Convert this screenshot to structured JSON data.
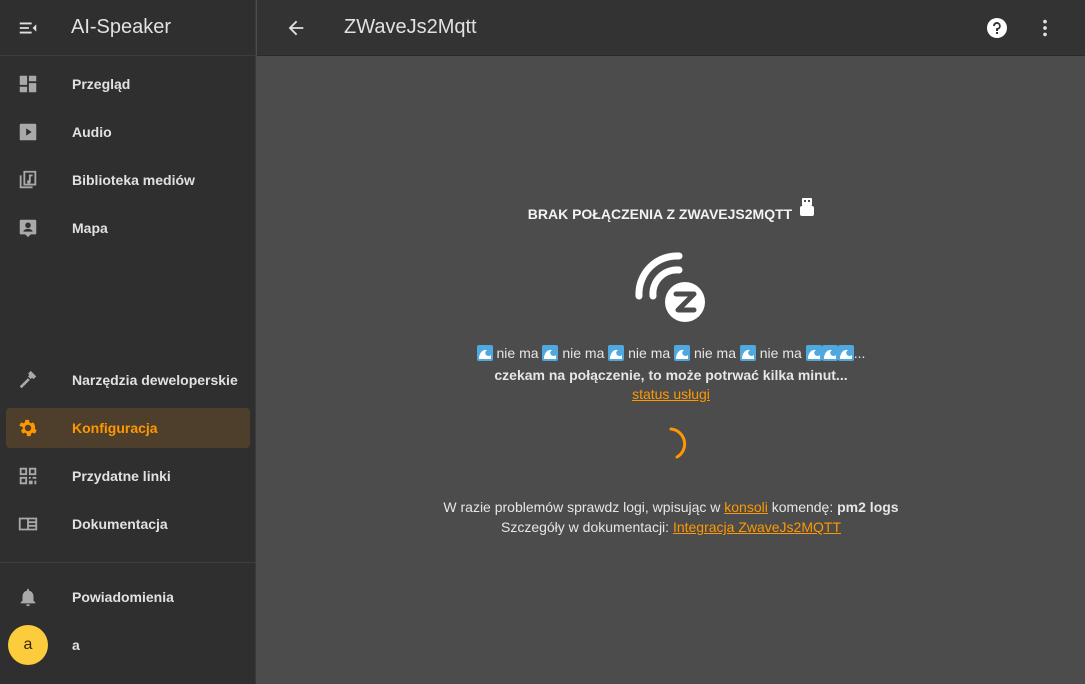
{
  "sidebar": {
    "app_title": "AI-Speaker",
    "items": [
      {
        "label": "Przegląd",
        "icon": "dashboard-icon"
      },
      {
        "label": "Audio",
        "icon": "play-box-icon"
      },
      {
        "label": "Biblioteka mediów",
        "icon": "music-library-icon"
      },
      {
        "label": "Mapa",
        "icon": "account-box-icon"
      },
      {
        "label": "Narzędzia deweloperskie",
        "icon": "hammer-icon"
      },
      {
        "label": "Konfiguracja",
        "icon": "gear-icon"
      },
      {
        "label": "Przydatne linki",
        "icon": "qrcode-icon"
      },
      {
        "label": "Dokumentacja",
        "icon": "book-icon"
      }
    ],
    "notifications_label": "Powiadomienia",
    "user_initial": "a",
    "user_name": "a"
  },
  "topbar": {
    "title": "ZWaveJs2Mqtt"
  },
  "main": {
    "heading": "BRAK POŁĄCZENIA Z ZWAVEJS2MQTT",
    "nie_ma": "nie ma",
    "ellipsis": "...",
    "waiting": "czekam na połączenie, to może potrwać kilka minut...",
    "status_link": "status usługi",
    "help_prefix": "W razie problemów sprawdz logi, wpisując w ",
    "console_link": "konsoli",
    "help_middle": " komendę: ",
    "command": "pm2 logs",
    "details_prefix": "Szczegóły w dokumentacji: ",
    "docs_link": "Integracja ZwaveJs2MQTT"
  },
  "colors": {
    "accent": "#ff9800",
    "sidebar_bg": "#2f2f2f",
    "main_bg": "#4c4c4c",
    "avatar": "#fdcc3c"
  }
}
